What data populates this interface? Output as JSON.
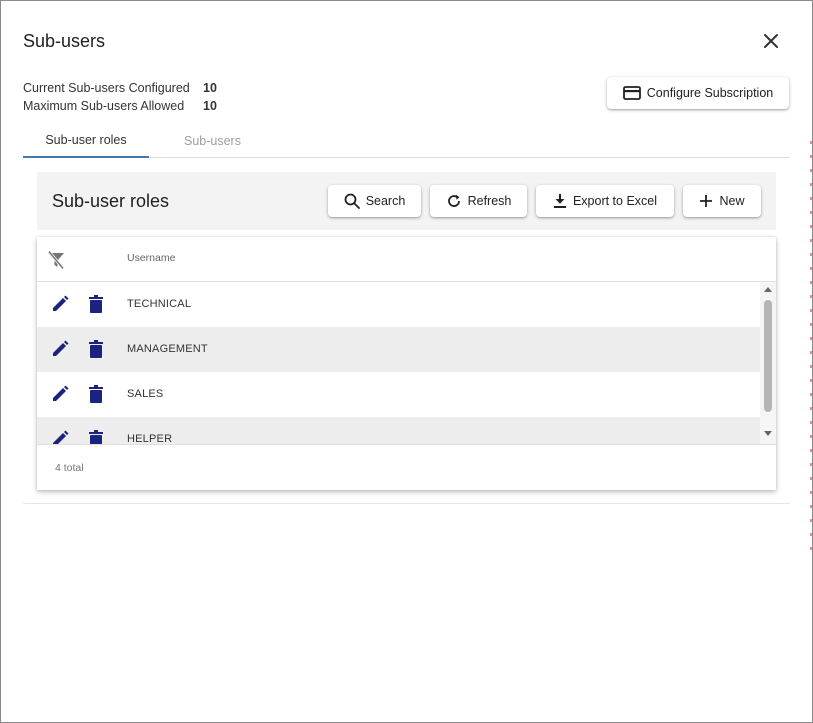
{
  "dialog": {
    "title": "Sub-users"
  },
  "summary": {
    "configured_label": "Current Sub-users Configured",
    "configured_value": "10",
    "max_label": "Maximum Sub-users Allowed",
    "max_value": "10"
  },
  "configure_button": {
    "label": "Configure Subscription",
    "icon": "credit-card-icon"
  },
  "tabs": [
    {
      "label": "Sub-user roles",
      "active": true
    },
    {
      "label": "Sub-users",
      "active": false
    }
  ],
  "toolbar": {
    "title": "Sub-user roles",
    "search_label": "Search",
    "refresh_label": "Refresh",
    "export_label": "Export to Excel",
    "new_label": "New"
  },
  "grid": {
    "columns": [
      "Username"
    ],
    "rows": [
      {
        "username": "TECHNICAL"
      },
      {
        "username": "MANAGEMENT"
      },
      {
        "username": "SALES"
      },
      {
        "username": "HELPER"
      }
    ],
    "total_text": "4 total"
  },
  "colors": {
    "accent": "#3f78b5",
    "icon": "#1a237e",
    "row_alt": "#ededed",
    "toolbar_bg": "#f3f3f3"
  }
}
